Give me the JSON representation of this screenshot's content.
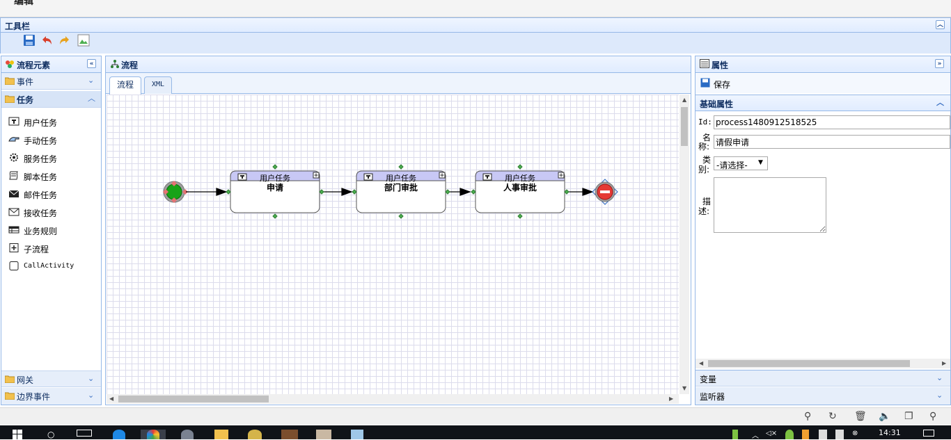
{
  "top": {
    "title": "编辑"
  },
  "toolbar": {
    "title": "工具栏",
    "icons": [
      "save-icon",
      "undo-icon",
      "redo-icon",
      "image-icon"
    ]
  },
  "left": {
    "title": "流程元素",
    "sections": {
      "events": "事件",
      "tasks": "任务",
      "gateway": "网关",
      "boundary": "边界事件"
    },
    "items": [
      {
        "label": "用户任务",
        "icon": "user-task-icon"
      },
      {
        "label": "手动任务",
        "icon": "manual-task-icon"
      },
      {
        "label": "服务任务",
        "icon": "service-task-icon"
      },
      {
        "label": "脚本任务",
        "icon": "script-task-icon"
      },
      {
        "label": "邮件任务",
        "icon": "mail-task-icon"
      },
      {
        "label": "接收任务",
        "icon": "receive-task-icon"
      },
      {
        "label": "业务规则",
        "icon": "business-rule-icon"
      },
      {
        "label": "子流程",
        "icon": "subprocess-icon"
      },
      {
        "label": "CallActivity",
        "icon": "call-activity-icon"
      }
    ]
  },
  "center": {
    "title": "流程",
    "tabs": [
      "流程",
      "XML"
    ],
    "diagram": {
      "tasks": [
        {
          "type": "用户任务",
          "name": "申请"
        },
        {
          "type": "用户任务",
          "name": "部门审批"
        },
        {
          "type": "用户任务",
          "name": "人事审批"
        }
      ],
      "start": "start-event",
      "end": "end-event"
    }
  },
  "right": {
    "title": "属性",
    "save": "保存",
    "basic": "基础属性",
    "fields": {
      "id_label": "Id:",
      "id_value": "process1480912518525",
      "name_label_1": "名",
      "name_label_2": "称:",
      "name_value": "请假申请",
      "category_label_1": "类",
      "category_label_2": "别:",
      "category_value": "-请选择-",
      "desc_label_1": "描",
      "desc_label_2": "述:"
    },
    "variables": "变量",
    "listeners": "监听器"
  },
  "taskbar": {
    "time": "14:31"
  }
}
